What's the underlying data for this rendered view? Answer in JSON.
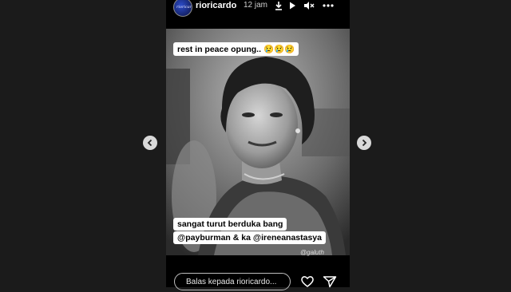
{
  "story": {
    "username": "rioricardo",
    "time_ago": "12 jam",
    "avatar_text": "rioricardo",
    "caption_top": "rest in peace opung.. 😢😢😢",
    "caption_line1": "sangat turut berduka bang",
    "caption_line2_mention1": "@payburman",
    "caption_line2_middle": " & ka ",
    "caption_line2_mention2": "@ireneanastasya",
    "watermark": "@galuth"
  },
  "reply": {
    "placeholder": "Balas kepada rioricardo..."
  },
  "icons": {
    "download": "download-icon",
    "play": "play-icon",
    "mute": "mute-icon",
    "more": "more-icon",
    "prev": "chevron-left-icon",
    "next": "chevron-right-icon",
    "like": "heart-icon",
    "send": "send-icon"
  },
  "colors": {
    "background": "#1b1b1b",
    "caption_bg": "#ffffff",
    "caption_text": "#000000"
  }
}
